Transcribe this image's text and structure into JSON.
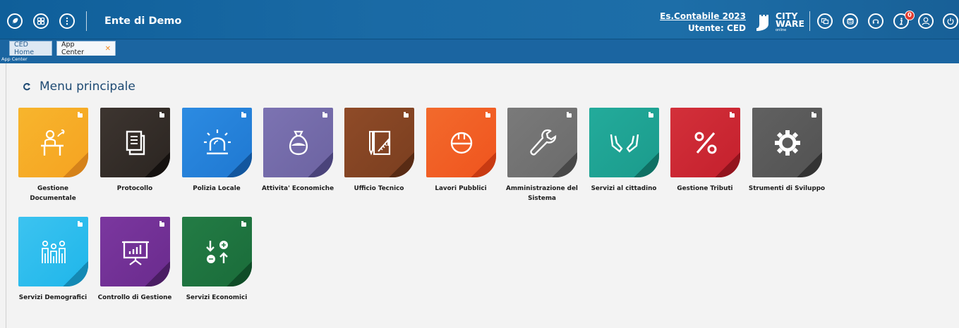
{
  "header": {
    "title": "Ente di Demo",
    "esercizio": "Es.Contabile 2023",
    "utente": "Utente: CED",
    "logo": {
      "line1": "CITY",
      "line2": "WARE",
      "line3": "online"
    },
    "notification_count": "0",
    "icons_left": [
      "rocket-icon",
      "grid-icon",
      "more-icon"
    ],
    "icons_right": [
      "windows-icon",
      "database-icon",
      "headset-icon",
      "info-icon",
      "user-icon",
      "power-icon"
    ]
  },
  "tabs": [
    {
      "label": "CED Home"
    },
    {
      "label": "App Center",
      "close": "✕"
    }
  ],
  "breadcrumb": "App Center",
  "main": {
    "title": "Menu principale"
  },
  "apps": [
    {
      "label": "Gestione Documentale",
      "color1": "#f6a321",
      "color2": "#f7b52d",
      "fold": "#d5821a"
    },
    {
      "label": "Protocollo",
      "color1": "#2b2521",
      "color2": "#3d3530",
      "fold": "#15110f"
    },
    {
      "label": "Polizia Locale",
      "color1": "#1f78d1",
      "color2": "#2c8be2",
      "fold": "#12569e"
    },
    {
      "label": "Attivita' Economiche",
      "color1": "#6c63a1",
      "color2": "#7c73b2",
      "fold": "#4a437a"
    },
    {
      "label": "Ufficio Tecnico",
      "color1": "#7a3e1f",
      "color2": "#8f4b28",
      "fold": "#582b14"
    },
    {
      "label": "Lavori Pubblici",
      "color1": "#f0541e",
      "color2": "#f26a2c",
      "fold": "#c83a12"
    },
    {
      "label": "Amministrazione del Sistema",
      "color1": "#6b6b6b",
      "color2": "#7a7a7a",
      "fold": "#484848"
    },
    {
      "label": "Servizi al cittadino",
      "color1": "#1b9b8c",
      "color2": "#23ab9b",
      "fold": "#0f7064"
    },
    {
      "label": "Gestione Tributi",
      "color1": "#c4202d",
      "color2": "#d3303a",
      "fold": "#93141e"
    },
    {
      "label": "Strumenti di Sviluppo",
      "color1": "#525252",
      "color2": "#616161",
      "fold": "#333333"
    },
    {
      "label": "Servizi Demografici",
      "color1": "#1fb6ea",
      "color2": "#3cc3f0",
      "fold": "#1489b4"
    },
    {
      "label": "Controllo di Gestione",
      "color1": "#6a2b8d",
      "color2": "#7b379f",
      "fold": "#4a1d63"
    },
    {
      "label": "Servizi Economici",
      "color1": "#1a6c3a",
      "color2": "#237c45",
      "fold": "#0f4c27"
    }
  ]
}
